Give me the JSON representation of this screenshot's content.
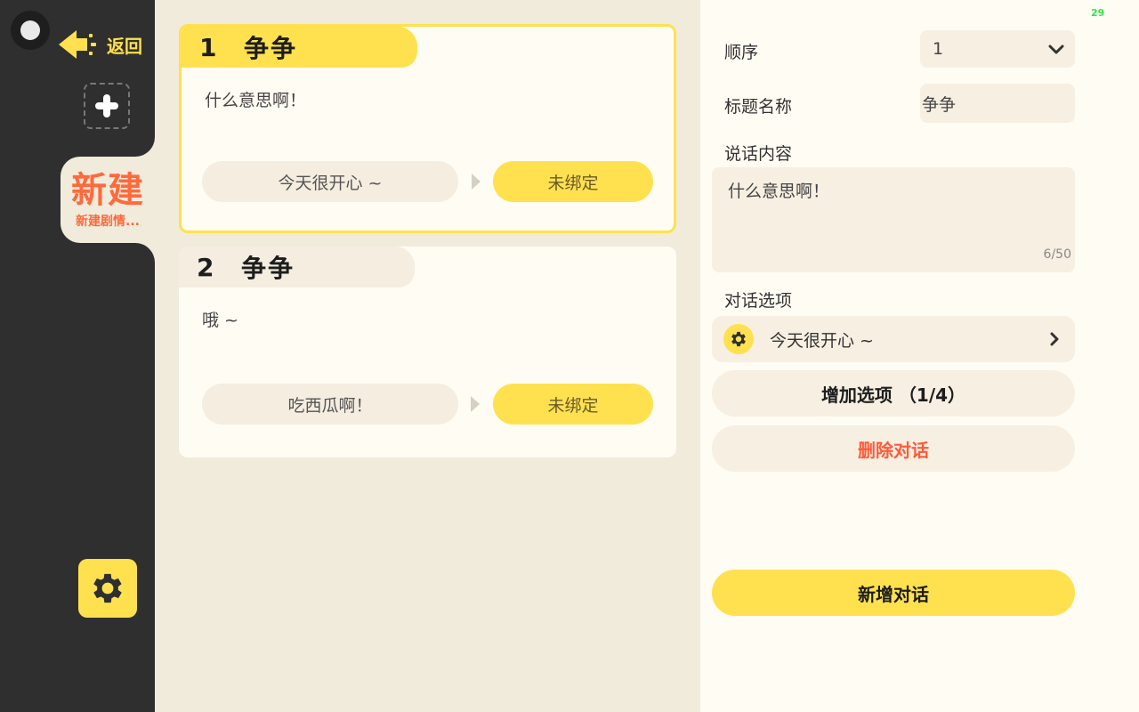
{
  "sidebar": {
    "back_label": "返回",
    "tab": {
      "title": "新建",
      "subtitle": "新建剧情..."
    }
  },
  "dialogs": [
    {
      "index": "1",
      "name": "争争",
      "text": "什么意思啊！",
      "option": "今天很开心 ~",
      "binding": "未绑定",
      "selected": true
    },
    {
      "index": "2",
      "name": "争争",
      "text": "哦 ~",
      "option": "吃西瓜啊！",
      "binding": "未绑定",
      "selected": false
    }
  ],
  "panel": {
    "fps": "29",
    "order_label": "顺序",
    "order_value": "1",
    "title_label": "标题名称",
    "title_value": "争争",
    "content_label": "说话内容",
    "content_value": "什么意思啊！",
    "content_counter": "6/50",
    "options_label": "对话选项",
    "options": [
      {
        "text": "今天很开心 ~"
      }
    ],
    "add_option_button": "增加选项 （1/4）",
    "delete_button": "删除对话",
    "new_dialog_button": "新增对话"
  },
  "colors": {
    "accent_yellow": "#ffe14f",
    "danger": "#ff5a3a",
    "tab_orange": "#ff6a3d",
    "sidebar_bg": "#2f2f2f",
    "canvas_bg": "#f1ebdc",
    "panel_bg": "#fffcf3"
  }
}
